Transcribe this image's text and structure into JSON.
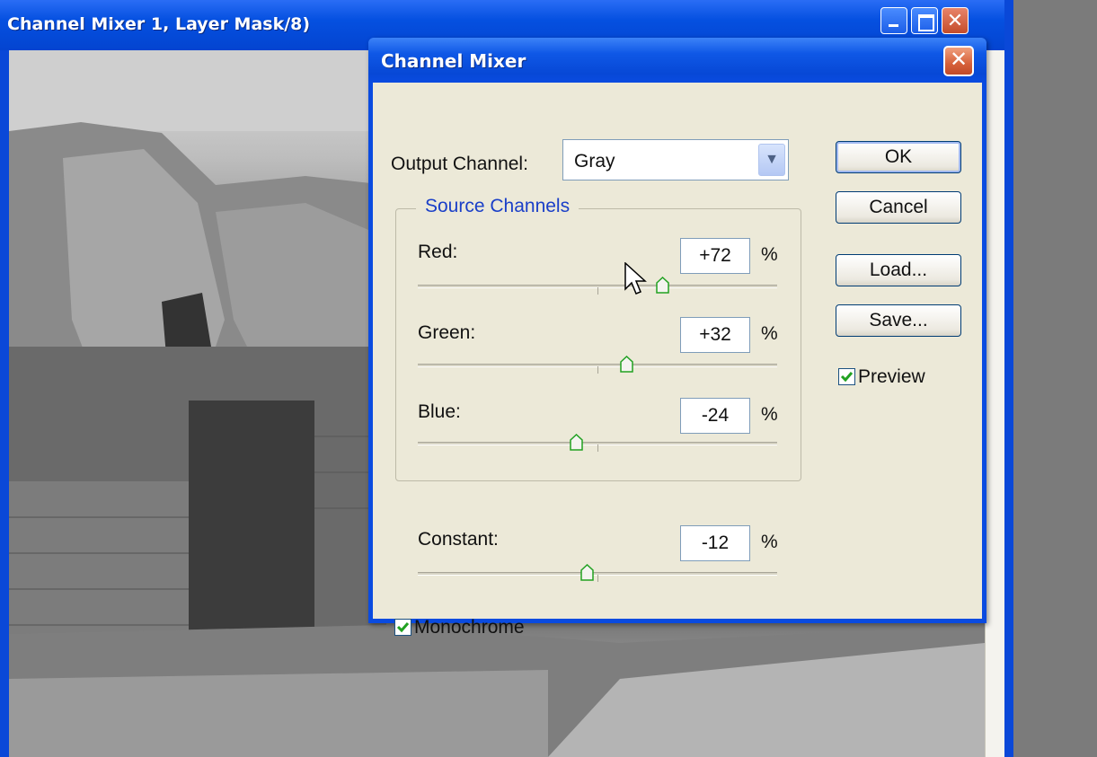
{
  "document": {
    "title": "Channel Mixer 1, Layer Mask/8)"
  },
  "dialog": {
    "title": "Channel Mixer",
    "output_channel_label": "Output Channel:",
    "output_channel_value": "Gray",
    "source_channels_legend": "Source Channels",
    "channels": [
      {
        "label": "Red:",
        "value": "+72",
        "unit": "%",
        "percent": 72
      },
      {
        "label": "Green:",
        "value": "+32",
        "unit": "%",
        "percent": 32
      },
      {
        "label": "Blue:",
        "value": "-24",
        "unit": "%",
        "percent": -24
      }
    ],
    "constant": {
      "label": "Constant:",
      "value": "-12",
      "unit": "%",
      "percent": -12
    },
    "buttons": {
      "ok": "OK",
      "cancel": "Cancel",
      "load": "Load...",
      "save": "Save..."
    },
    "preview": {
      "label": "Preview",
      "checked": true
    },
    "monochrome": {
      "label": "Monochrome",
      "checked": true
    }
  },
  "colors": {
    "titlebar_blue": "#0a4be0",
    "dialog_face": "#ece9d8",
    "close_red": "#d6603a",
    "check_green": "#21a121"
  }
}
